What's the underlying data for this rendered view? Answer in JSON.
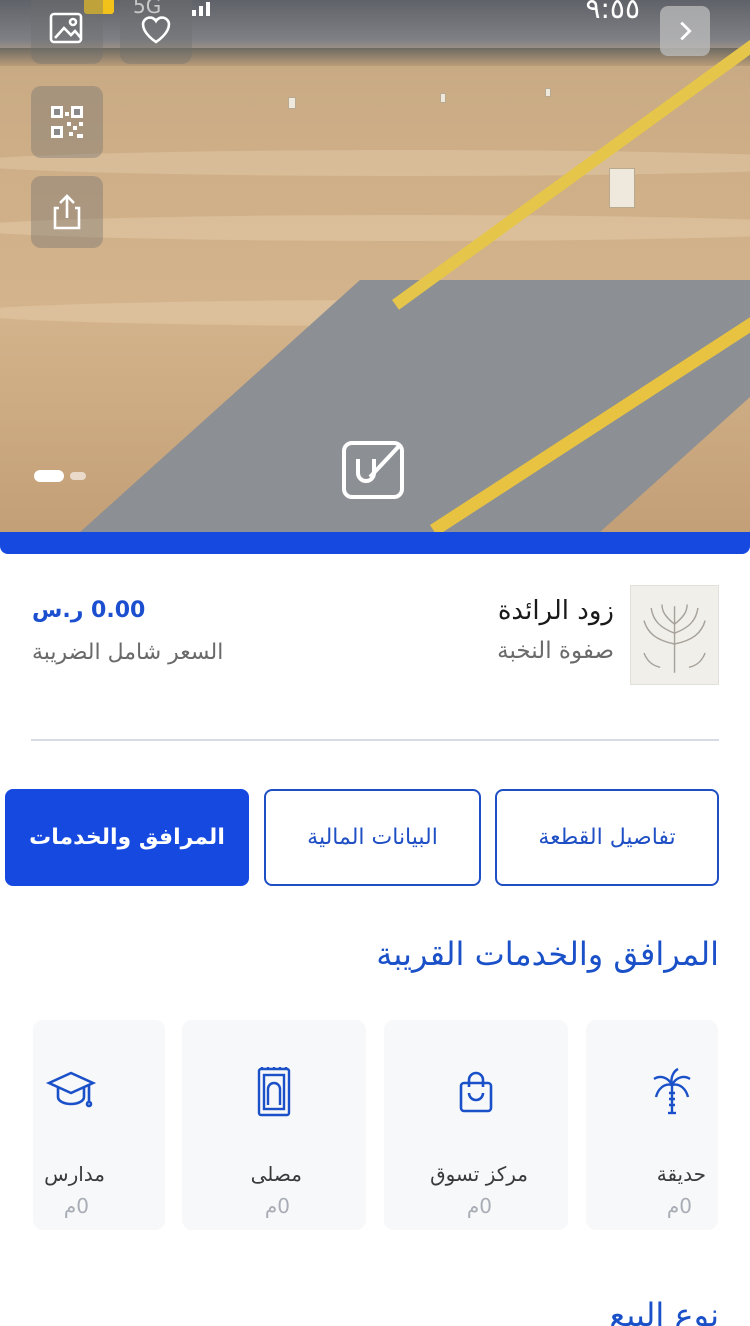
{
  "status_bar": {
    "time": "٩:٥٥",
    "network": "5G"
  },
  "project": {
    "name": "زود الرائدة",
    "developer": "صفوة النخبة",
    "price": "0.00 ر.س",
    "price_note": "السعر شامل الضريبة"
  },
  "tabs": [
    {
      "label": "تفاصيل القطعة",
      "active": false
    },
    {
      "label": "البيانات المالية",
      "active": false
    },
    {
      "label": "المرافق والخدمات",
      "active": true
    }
  ],
  "facilities_section": {
    "title": "المرافق والخدمات القريبة",
    "items": [
      {
        "label": "حديقة",
        "distance": "0م",
        "icon": "palm-tree-icon"
      },
      {
        "label": "مركز تسوق",
        "distance": "0م",
        "icon": "shopping-bag-icon"
      },
      {
        "label": "مصلى",
        "distance": "0م",
        "icon": "prayer-mat-icon"
      },
      {
        "label": "مدارس",
        "distance": "0م",
        "icon": "graduation-cap-icon"
      }
    ]
  },
  "next_section": {
    "title": "نوع البيع"
  },
  "colors": {
    "primary": "#1549e0",
    "heading": "#1a50c8",
    "muted": "#6a6a6a"
  }
}
